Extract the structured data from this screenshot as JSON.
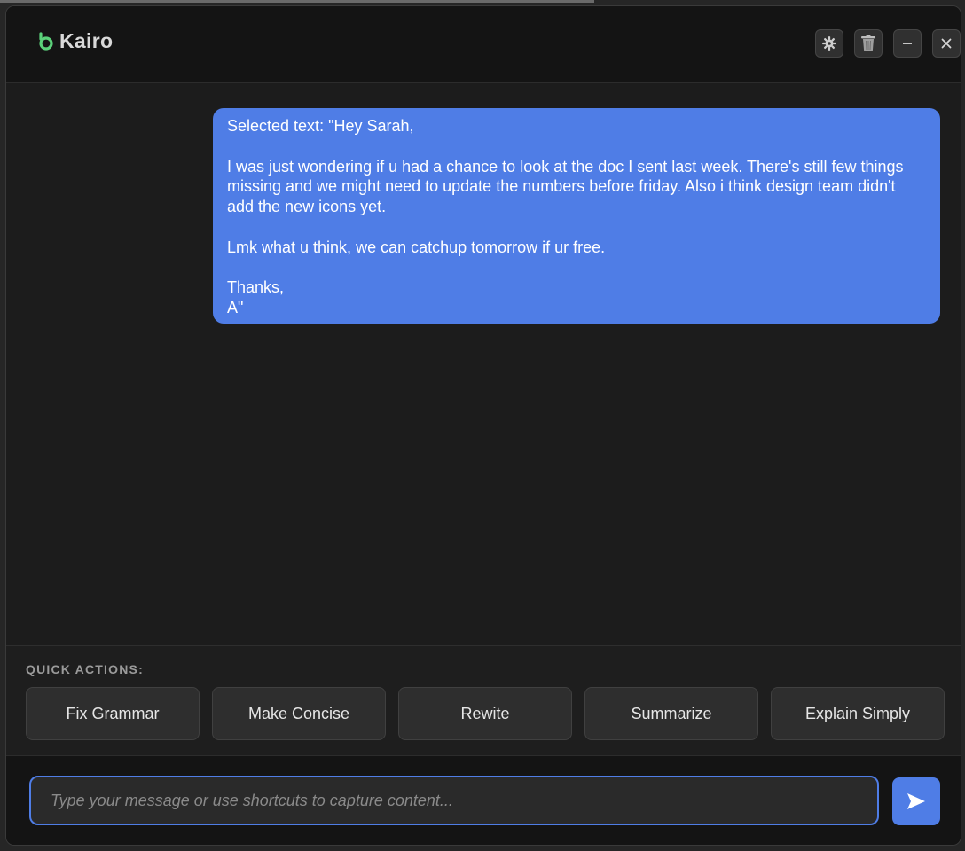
{
  "app": {
    "name": "Kairo",
    "accent_color": "#4f7de6",
    "logo_color": "#5bd17a"
  },
  "window_controls": [
    {
      "name": "settings",
      "icon": "gear-icon"
    },
    {
      "name": "clear",
      "icon": "trash-icon"
    },
    {
      "name": "minimize",
      "icon": "minimize-icon"
    },
    {
      "name": "close",
      "icon": "close-icon"
    }
  ],
  "chat": {
    "messages": [
      {
        "role": "user",
        "text": "Selected text: \"Hey Sarah,\n\nI was just wondering if u had a chance to look at the doc I sent last week. There's still few things missing and we might need to update the numbers before friday. Also i think design team didn't add the new icons yet.\n\nLmk what u think, we can catchup tomorrow if ur free.\n\nThanks,\nA\""
      }
    ]
  },
  "quick_actions": {
    "label": "QUICK ACTIONS:",
    "buttons": [
      {
        "label": "Fix Grammar"
      },
      {
        "label": "Make Concise"
      },
      {
        "label": "Rewite"
      },
      {
        "label": "Summarize"
      },
      {
        "label": "Explain Simply"
      }
    ]
  },
  "composer": {
    "value": "",
    "placeholder": "Type your message or use shortcuts to capture content..."
  }
}
